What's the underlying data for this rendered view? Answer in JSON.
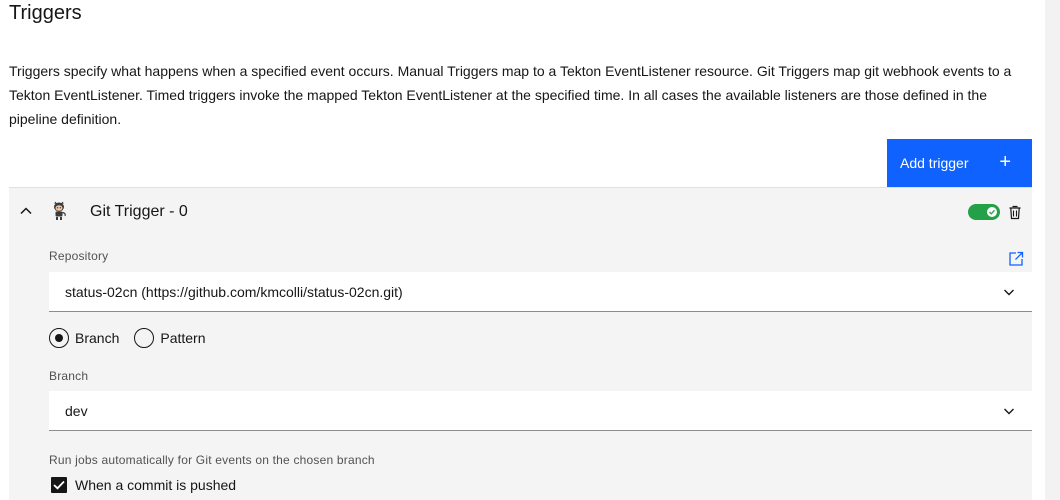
{
  "page": {
    "title": "Triggers",
    "description": "Triggers specify what happens when a specified event occurs. Manual Triggers map to a Tekton EventListener resource. Git Triggers map git webhook events to a Tekton EventListener. Timed triggers invoke the mapped Tekton EventListener at the specified time. In all cases the available listeners are those defined in the pipeline definition."
  },
  "toolbar": {
    "add_trigger_label": "Add trigger",
    "add_trigger_icon": "+"
  },
  "trigger": {
    "name": "Git Trigger - 0",
    "enabled": true,
    "repository_label": "Repository",
    "repository_value": "status-02cn (https://github.com/kmcolli/status-02cn.git)",
    "mode_options": [
      {
        "label": "Branch",
        "selected": true
      },
      {
        "label": "Pattern",
        "selected": false
      }
    ],
    "branch_label": "Branch",
    "branch_value": "dev",
    "run_jobs_label": "Run jobs automatically for Git events on the chosen branch",
    "commit_pushed_label": "When a commit is pushed",
    "commit_pushed_checked": true
  },
  "colors": {
    "primary": "#0f62fe",
    "toggle_on": "#24a148",
    "panel_bg": "#f4f4f4"
  }
}
